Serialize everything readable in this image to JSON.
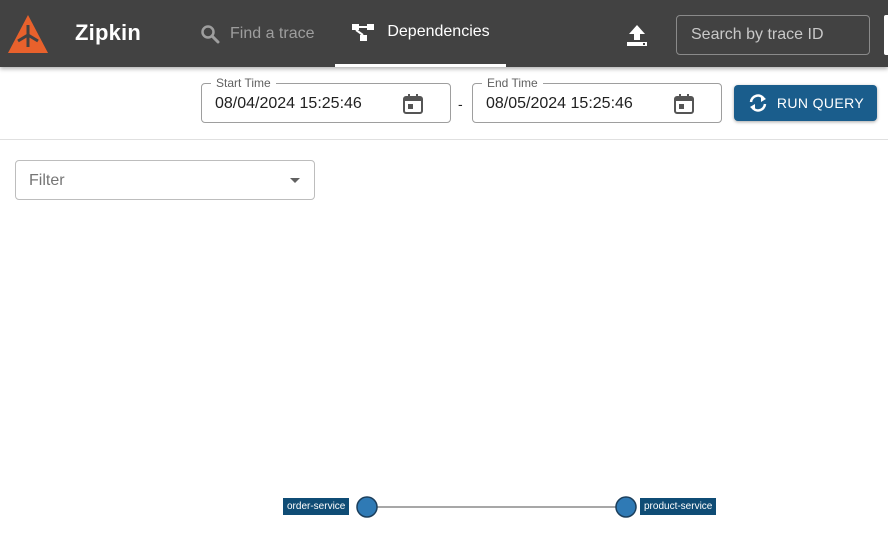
{
  "header": {
    "brand": "Zipkin",
    "nav": {
      "find_trace": "Find a trace",
      "dependencies": "Dependencies"
    },
    "trace_search": {
      "placeholder": "Search by trace ID"
    }
  },
  "query": {
    "start_time": {
      "label": "Start Time",
      "value": "08/04/2024 15:25:46"
    },
    "separator": "-",
    "end_time": {
      "label": "End Time",
      "value": "08/05/2024 15:25:46"
    },
    "run_label": "RUN QUERY"
  },
  "filter": {
    "placeholder": "Filter"
  },
  "graph": {
    "nodes": [
      {
        "name": "order-service"
      },
      {
        "name": "product-service"
      }
    ]
  },
  "colors": {
    "header_bg": "#424242",
    "accent": "#1a5d8c",
    "logo": "#e8612c",
    "node_fill": "#2f7ab5",
    "label_bg": "#0f4c75"
  },
  "icons": {
    "logo": "zipkin-logo-icon",
    "find": "search-icon",
    "dependencies": "graph-network-icon",
    "upload": "upload-icon",
    "calendar": "calendar-icon",
    "refresh": "refresh-icon",
    "dropdown": "chevron-down-icon"
  }
}
